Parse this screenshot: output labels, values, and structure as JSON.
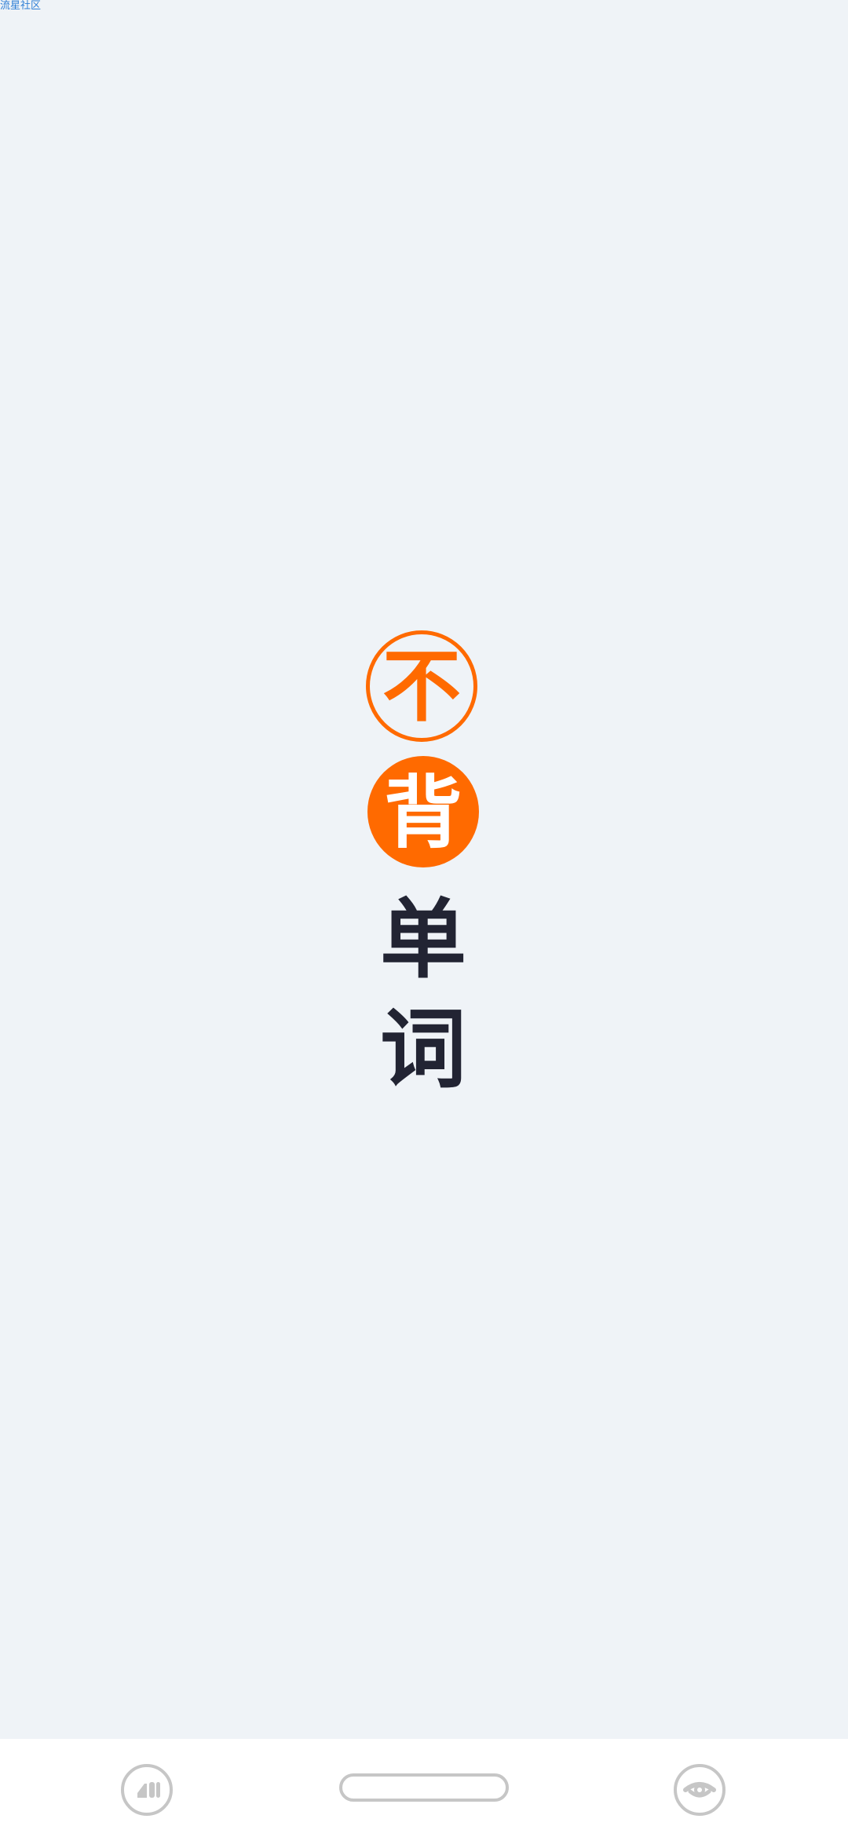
{
  "status": {
    "watermark": "流星社区"
  },
  "splash": {
    "logo_chars": [
      "不",
      "背",
      "单",
      "词"
    ],
    "colors": {
      "background": "#eff3f7",
      "accent": "#ff6a00",
      "text_dark": "#222433"
    }
  },
  "navbar": {
    "left_icon": "split-screen-icon",
    "center_icon": "home-pill",
    "right_icon": "eye-icon",
    "icon_color": "#c6c6c6"
  }
}
